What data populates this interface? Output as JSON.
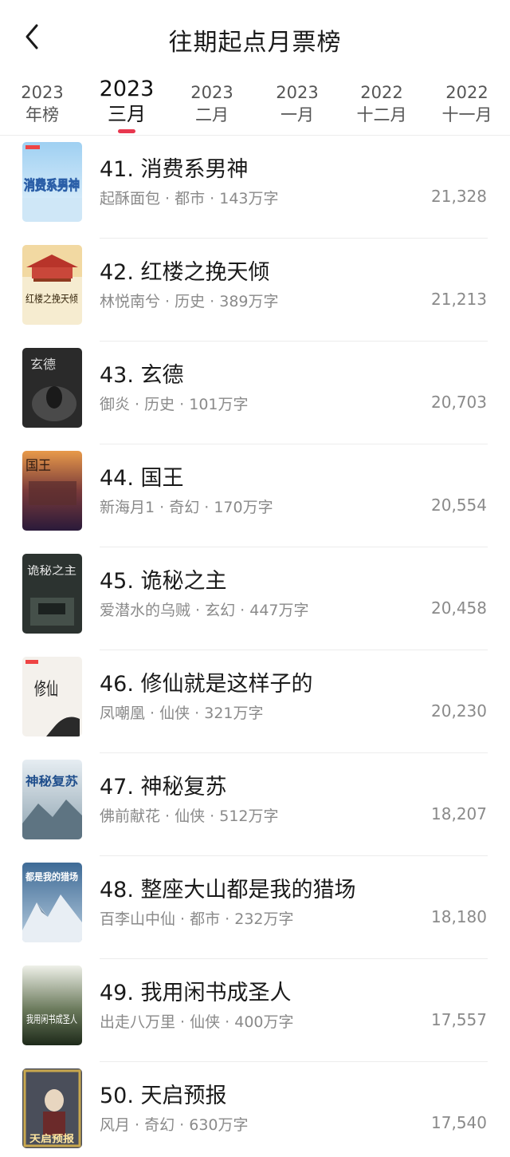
{
  "header": {
    "title": "往期起点月票榜"
  },
  "tabs": [
    {
      "year": "2023",
      "label": "年榜",
      "active": false
    },
    {
      "year": "2023",
      "label": "三月",
      "active": true
    },
    {
      "year": "2023",
      "label": "二月",
      "active": false
    },
    {
      "year": "2023",
      "label": "一月",
      "active": false
    },
    {
      "year": "2022",
      "label": "十二月",
      "active": false
    },
    {
      "year": "2022",
      "label": "十一月",
      "active": false
    }
  ],
  "accent_color": "#e8384f",
  "books": [
    {
      "title": "41. 消费系男神",
      "meta": "起酥面包 · 都市 · 143万字",
      "votes": "21,328",
      "cover_text": "消费系男神"
    },
    {
      "title": "42. 红楼之挽天倾",
      "meta": "林悦南兮 · 历史 · 389万字",
      "votes": "21,213",
      "cover_text": "红楼之挽天倾"
    },
    {
      "title": "43. 玄德",
      "meta": "御炎 · 历史 · 101万字",
      "votes": "20,703",
      "cover_text": "玄德"
    },
    {
      "title": "44. 国王",
      "meta": "新海月1 · 奇幻 · 170万字",
      "votes": "20,554",
      "cover_text": "国王"
    },
    {
      "title": "45. 诡秘之主",
      "meta": "爱潜水的乌贼 · 玄幻 · 447万字",
      "votes": "20,458",
      "cover_text": "诡秘之主"
    },
    {
      "title": "46. 修仙就是这样子的",
      "meta": "凤嘲凰 · 仙侠 · 321万字",
      "votes": "20,230",
      "cover_text": "修仙"
    },
    {
      "title": "47. 神秘复苏",
      "meta": "佛前献花 · 仙侠 · 512万字",
      "votes": "18,207",
      "cover_text": "神秘复苏"
    },
    {
      "title": "48. 整座大山都是我的猎场",
      "meta": "百李山中仙 · 都市 · 232万字",
      "votes": "18,180",
      "cover_text": "都是我的猎场"
    },
    {
      "title": "49. 我用闲书成圣人",
      "meta": "出走八万里 · 仙侠 · 400万字",
      "votes": "17,557",
      "cover_text": "我用闲书成圣人"
    },
    {
      "title": "50. 天启预报",
      "meta": "风月 · 奇幻 · 630万字",
      "votes": "17,540",
      "cover_text": "天启预报"
    }
  ]
}
